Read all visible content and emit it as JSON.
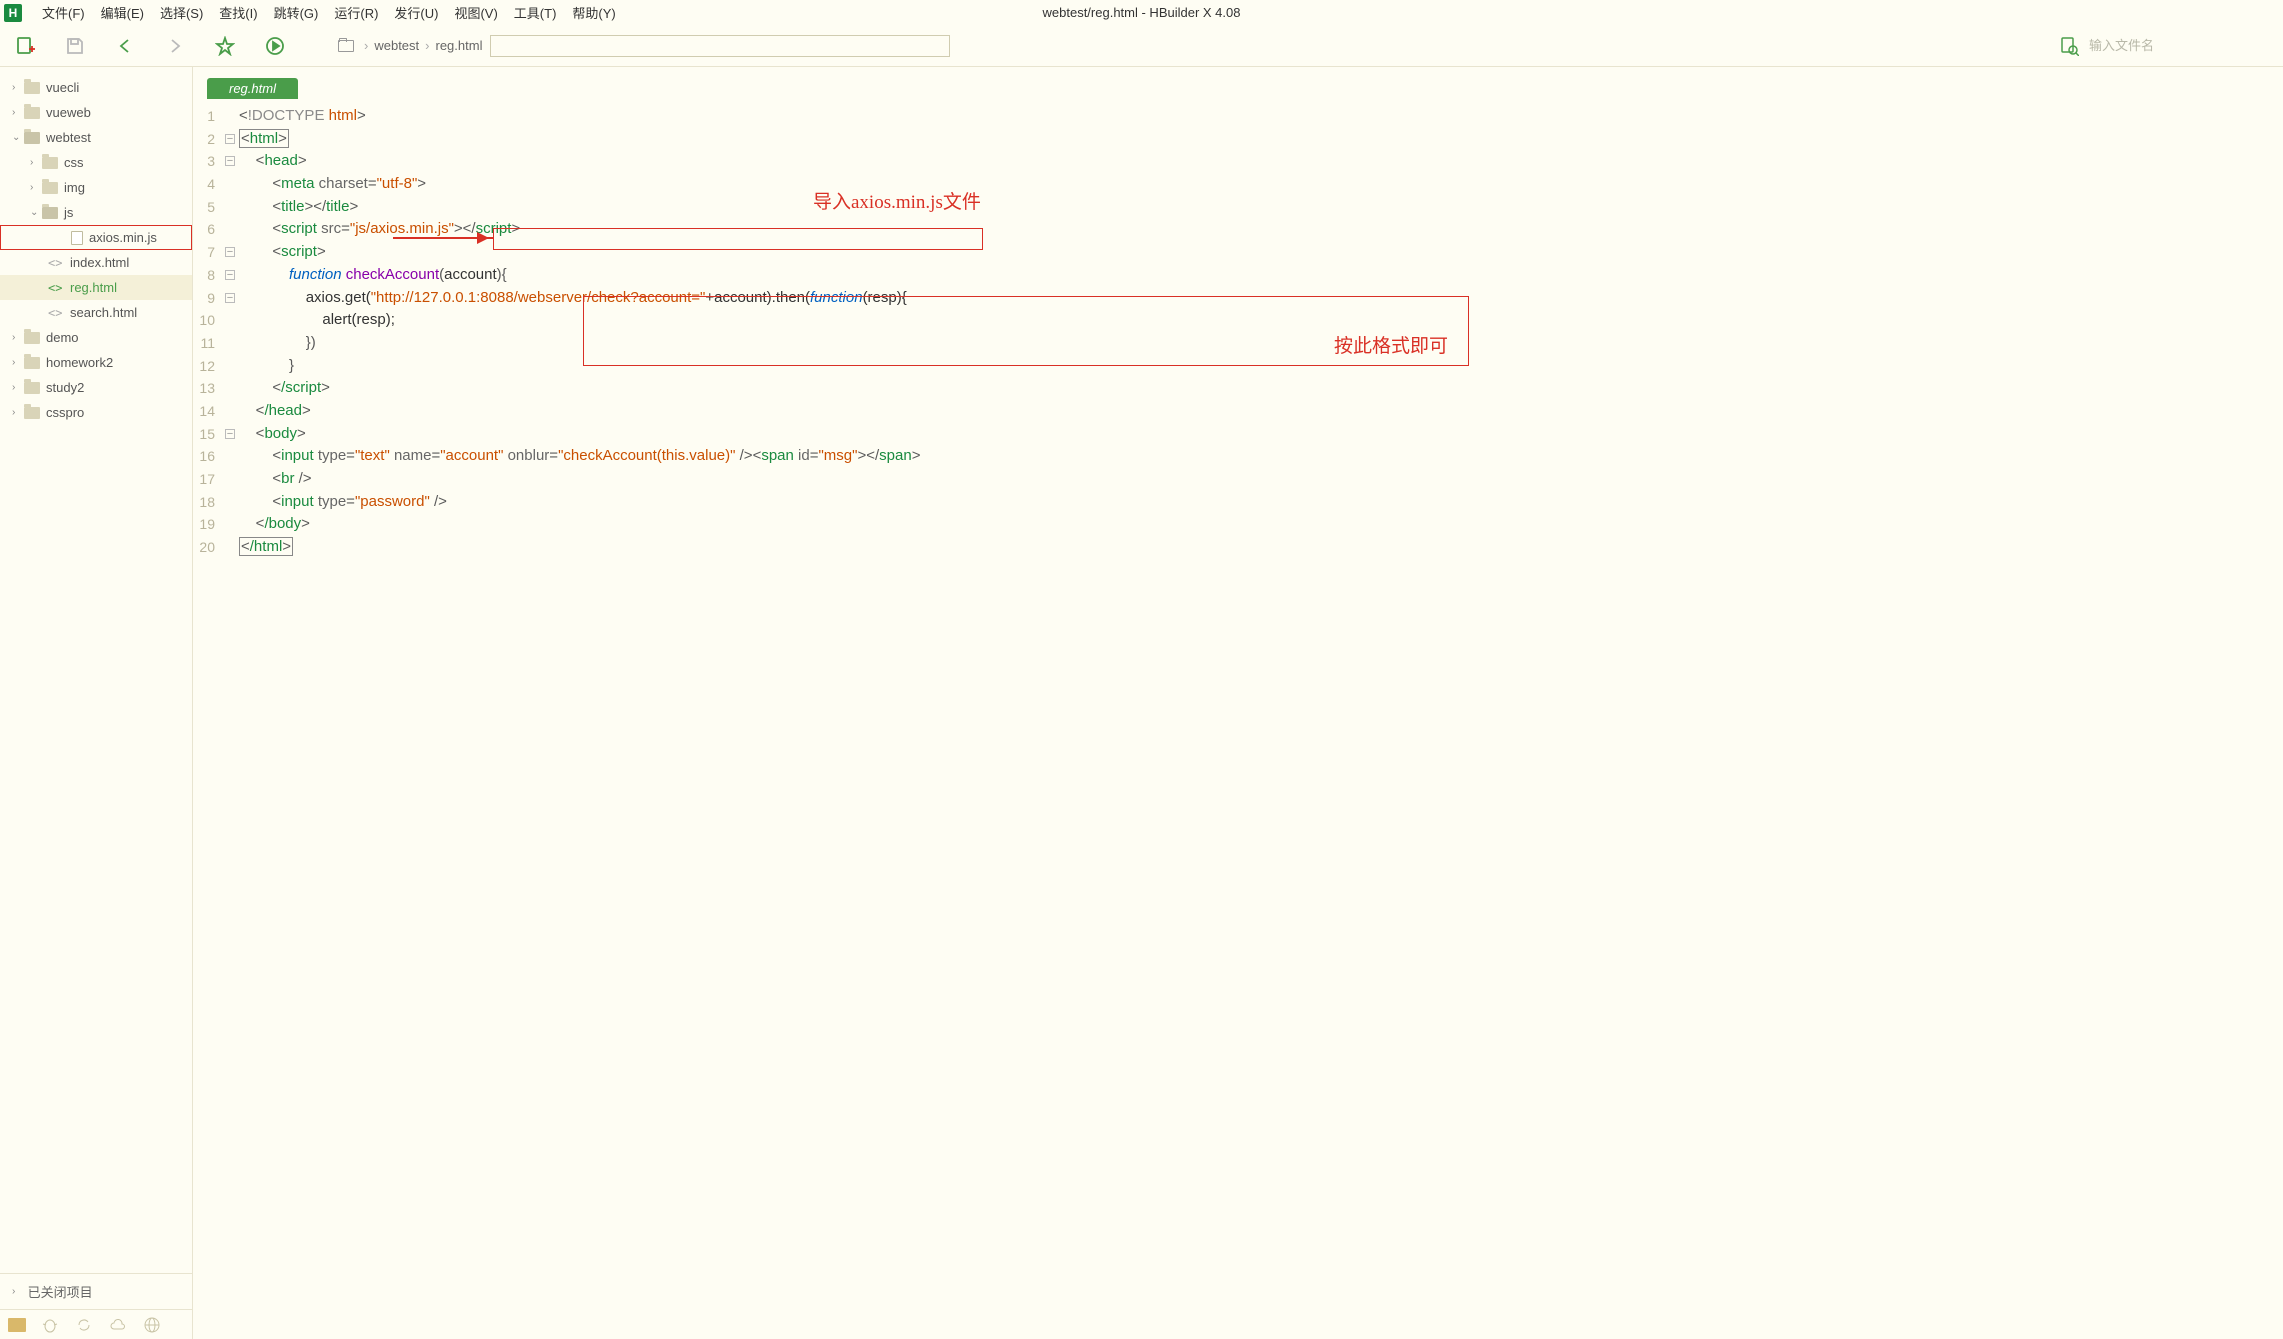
{
  "app": {
    "logo": "H",
    "title": "webtest/reg.html - HBuilder X 4.08"
  },
  "menu": {
    "file": "文件(F)",
    "edit": "编辑(E)",
    "select": "选择(S)",
    "find": "查找(I)",
    "goto": "跳转(G)",
    "run": "运行(R)",
    "publish": "发行(U)",
    "view": "视图(V)",
    "tools": "工具(T)",
    "help": "帮助(Y)"
  },
  "breadcrumb": {
    "project": "webtest",
    "file": "reg.html"
  },
  "search": {
    "placeholder": "输入文件名"
  },
  "tree": {
    "vuecli": "vuecli",
    "vueweb": "vueweb",
    "webtest": "webtest",
    "css": "css",
    "img": "img",
    "js": "js",
    "axios": "axios.min.js",
    "index": "index.html",
    "reg": "reg.html",
    "search": "search.html",
    "demo": "demo",
    "homework2": "homework2",
    "study2": "study2",
    "csspro": "csspro",
    "closed": "已关闭项目"
  },
  "tab": {
    "active": "reg.html"
  },
  "code": {
    "l1_doctype": "!DOCTYPE",
    "l1_html": "html",
    "l2": "html",
    "l3": "head",
    "l4_tag": "meta",
    "l4_attr": "charset",
    "l4_val": "\"utf-8\"",
    "l5": "title",
    "l6_tag": "script",
    "l6_attr": "src",
    "l6_val": "\"js/axios.min.js\"",
    "l7": "script",
    "l8_fn": "function",
    "l8_name": "checkAccount",
    "l8_arg": "account",
    "l9_axios": "axios",
    "l9_get": ".get(",
    "l9_url": "\"http://127.0.0.1:8088/webserver/check?account=\"",
    "l9_plus": "+account).then(",
    "l9_fn2": "function",
    "l9_resp": "(resp){",
    "l10": "alert(resp);",
    "l11": "})",
    "l12": "}",
    "l13": "/script",
    "l14": "/head",
    "l15": "body",
    "l16_input": "input",
    "l16_type_a": "type",
    "l16_type_v": "\"text\"",
    "l16_name_a": "name",
    "l16_name_v": "\"account\"",
    "l16_blur_a": "onblur",
    "l16_blur_v": "\"checkAccount(this.value)\"",
    "l16_span": "span",
    "l16_id_a": "id",
    "l16_id_v": "\"msg\"",
    "l17": "br",
    "l18_input": "input",
    "l18_type_a": "type",
    "l18_type_v": "\"password\"",
    "l19": "/body",
    "l20": "/html"
  },
  "annotations": {
    "import": "导入axios.min.js文件",
    "format": "按此格式即可"
  }
}
